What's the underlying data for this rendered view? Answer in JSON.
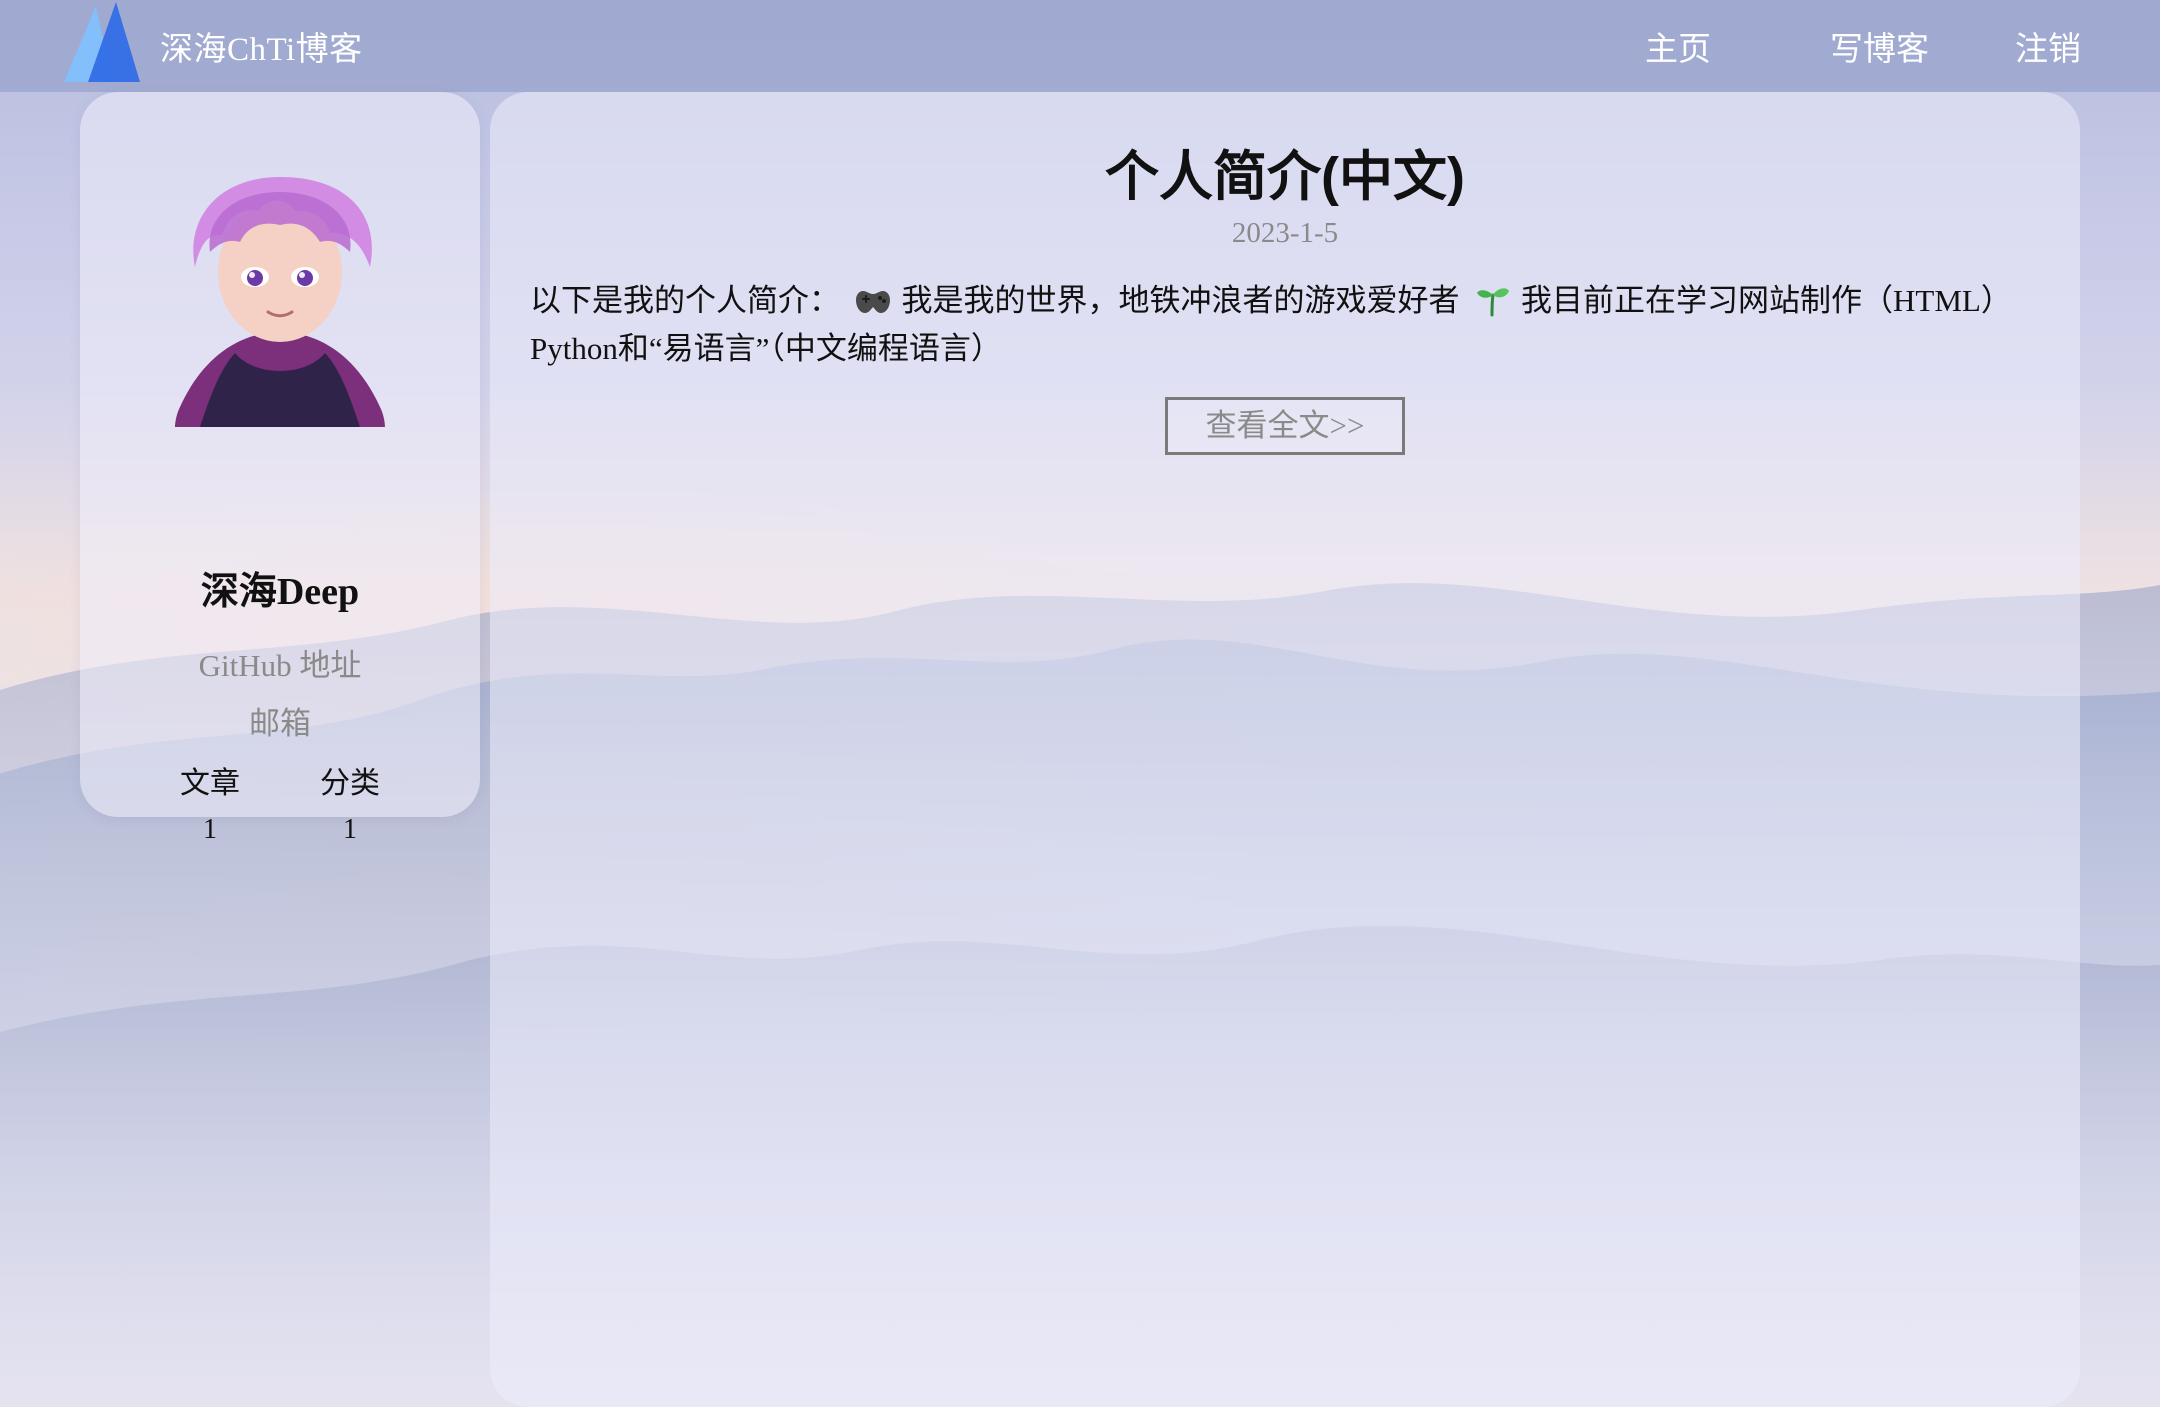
{
  "nav": {
    "title": "深海ChTi博客",
    "links": {
      "home": "主页",
      "write": "写博客",
      "logout": "注销"
    }
  },
  "profile": {
    "name": "深海Deep",
    "github_text": "GitHub 地址",
    "email_text": "邮箱",
    "stats": {
      "articles_label": "文章",
      "articles_value": "1",
      "categories_label": "分类",
      "categories_value": "1"
    }
  },
  "article": {
    "title": "个人简介(中文)",
    "date": "2023-1-5",
    "summary_part1": "以下是我的个人简介：",
    "summary_part2": "我是我的世界，地铁冲浪者的游戏爱好者",
    "summary_part3": "我目前正在学习网站制作（HTML）Python和“易语言”（中文编程语言）",
    "emoji_1_name": "game-controller-icon",
    "emoji_2_name": "seedling-icon",
    "read_more": "查看全文>>"
  },
  "colors": {
    "nav_bg": "#929cc6",
    "accent_blue": "#2f6be7",
    "muted_text": "#8a8a8a",
    "text": "#111111"
  },
  "icons": {
    "logo": "site-logo-icon",
    "avatar": "anime-avatar-image"
  }
}
